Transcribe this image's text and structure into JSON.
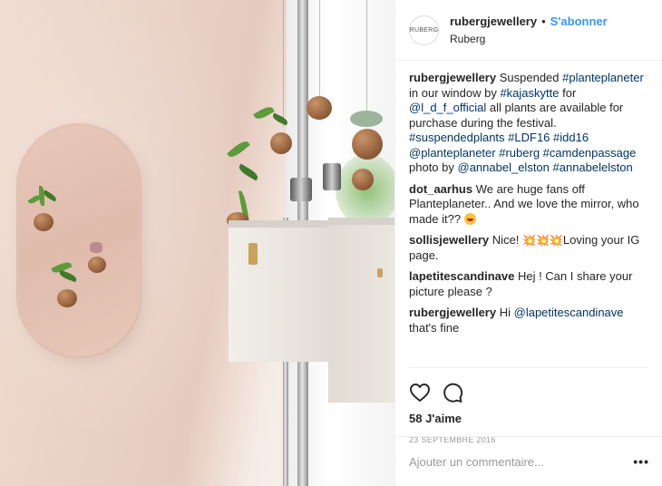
{
  "post": {
    "avatar_text": "RUBERG",
    "username": "rubergjewellery",
    "separator": "•",
    "follow_label": "S'abonner",
    "location": "Ruberg"
  },
  "caption": {
    "user": "rubergjewellery",
    "t1": "Suspended ",
    "h1": "#planteplaneter",
    "t2": " in our window by ",
    "h2": "#kajaskytte",
    "t3": " for ",
    "h3": "@l_d_f_official",
    "t4": " all plants are available for purchase during the festival. ",
    "h4": "#suspendedplants",
    "h5": "#LDF16",
    "h6": "#idd16",
    "h7": "@planteplaneter",
    "h8": "#ruberg",
    "h9": "#camdenpassage",
    "t5": " photo by ",
    "h10": "@annabel_elston",
    "h11": "#annabelelston"
  },
  "comments": [
    {
      "user": "dot_aarhus",
      "text": "We are huge fans off Planteplaneter.. And we love the mirror, who made it?? "
    },
    {
      "user": "sollisjewellery",
      "text_before": "Nice! ",
      "sparkles": "💥💥💥",
      "text_after": "Loving your IG page."
    },
    {
      "user": "lapetitescandinave",
      "text": "Hej ! Can I share your picture please ?"
    },
    {
      "user": "rubergjewellery",
      "text_before": "Hi ",
      "mention": "@lapetitescandinave",
      "text_after": " that's fine"
    }
  ],
  "stats": {
    "likes": "58 J'aime",
    "date": "23 SEPTEMBRE 2016"
  },
  "add_comment": {
    "placeholder": "Ajouter un commentaire...",
    "more": "•••"
  },
  "icons": [
    "heart-icon",
    "comment-icon",
    "more-options-icon"
  ],
  "colors": {
    "link": "#003569",
    "follow": "#3897f0",
    "border": "#efefef"
  }
}
